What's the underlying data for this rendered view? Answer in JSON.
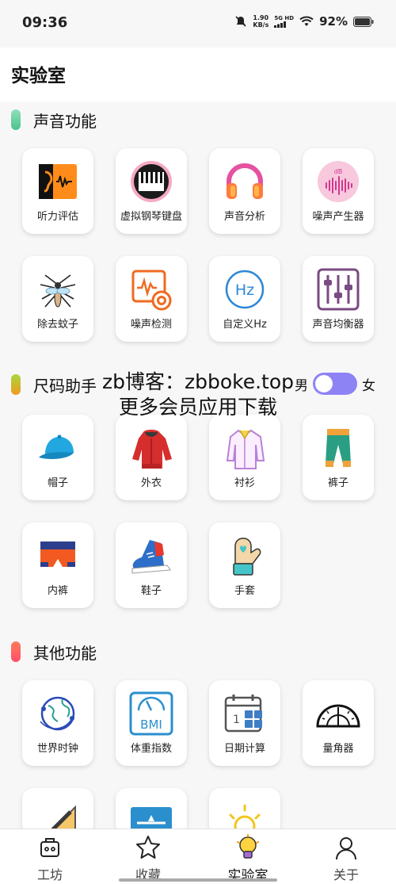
{
  "status_bar": {
    "time": "09:36",
    "net_speed_value": "1.90",
    "net_speed_unit": "KB/s",
    "signal_label": "5G HD",
    "battery": "92%"
  },
  "header": {
    "title": "实验室"
  },
  "sections": {
    "sound": {
      "title": "声音功能",
      "accent": "#5fd39b",
      "items": [
        "听力评估",
        "虚拟钢琴键盘",
        "声音分析",
        "噪声产生器",
        "除去蚊子",
        "噪声检测",
        "自定义Hz",
        "声音均衡器"
      ]
    },
    "size": {
      "title": "尺码助手",
      "accent": "#f0a12a",
      "items": [
        "帽子",
        "外衣",
        "衬衫",
        "裤子",
        "内裤",
        "鞋子",
        "手套"
      ]
    },
    "other": {
      "title": "其他功能",
      "accent": "#ff6c5a",
      "items": [
        "世界时钟",
        "体重指数",
        "日期计算",
        "量角器"
      ]
    }
  },
  "gender_toggle": {
    "male": "男",
    "female": "女",
    "color": "#8d83f5"
  },
  "watermark": {
    "line1": "zb博客：zbboke.top",
    "line2": "更多会员应用下载"
  },
  "bottom_nav": {
    "items": [
      "工坊",
      "收藏",
      "实验室",
      "关于"
    ],
    "active": "实验室"
  }
}
